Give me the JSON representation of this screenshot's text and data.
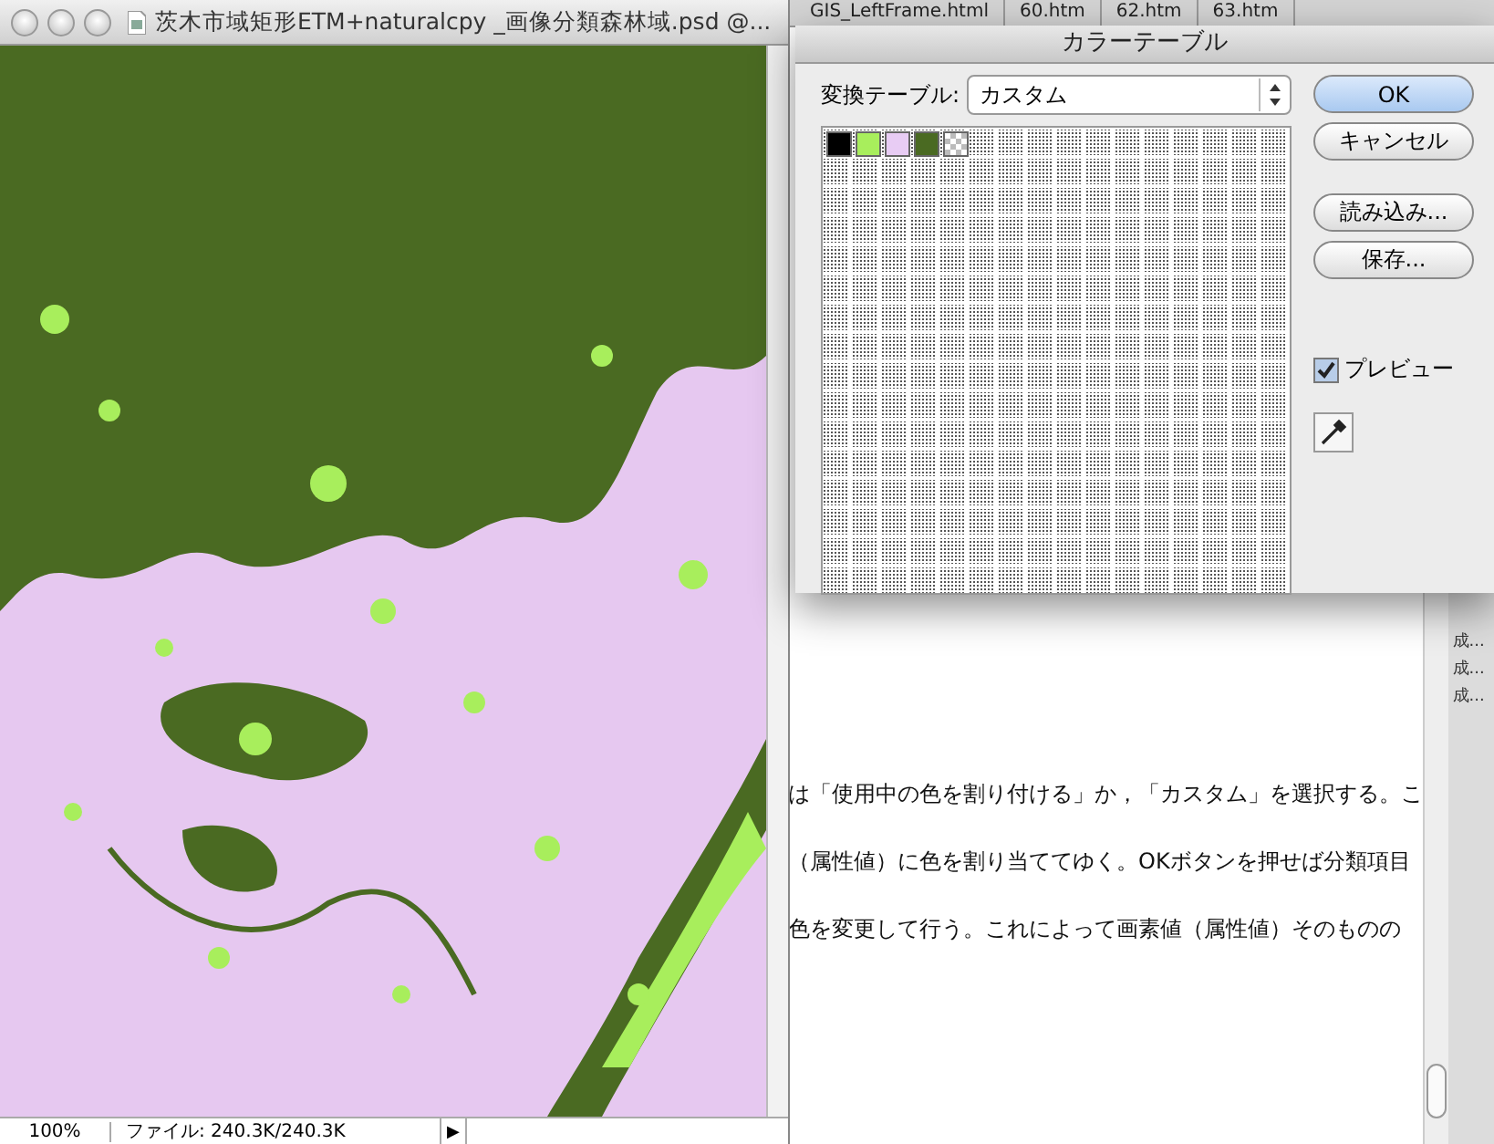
{
  "browser": {
    "tabs": [
      {
        "label": "GIS_LeftFrame.html",
        "selected": false
      },
      {
        "label": "60.htm",
        "selected": false
      },
      {
        "label": "62.htm",
        "selected": false
      },
      {
        "label": "63.htm",
        "selected": false
      }
    ],
    "paragraph_lines": [
      "は「使用中の色を割り付ける」か，「カスタム」を選択する。こ",
      "（属性値）に色を割り当ててゆく。OKボタンを押せば分類項目",
      "色を変更して行う。これによって画素値（属性値）そのものの"
    ],
    "sidebar_items": [
      "成...",
      "成...",
      "成..."
    ]
  },
  "image_window": {
    "title": "茨木市域矩形ETM+naturalcpy _画像分類森林域.psd @...",
    "zoom": "100%",
    "file_info": "ファイル: 240.3K/240.3K",
    "menu_arrow": "▶"
  },
  "dialog": {
    "title": "カラーテーブル",
    "table_label": "変換テーブル:",
    "table_value": "カスタム",
    "swatches": [
      {
        "kind": "color",
        "color": "#000000"
      },
      {
        "kind": "color",
        "color": "#a8ee5c"
      },
      {
        "kind": "color",
        "color": "#e8ccf4"
      },
      {
        "kind": "color",
        "color": "#4a6a22"
      },
      {
        "kind": "transparent"
      }
    ],
    "buttons": [
      {
        "label": "OK",
        "default": true
      },
      {
        "label": "キャンセル",
        "default": false
      },
      {
        "label": "読み込み...",
        "default": false
      },
      {
        "label": "保存...",
        "default": false
      }
    ],
    "preview": {
      "label": "プレビュー",
      "checked": true
    }
  }
}
